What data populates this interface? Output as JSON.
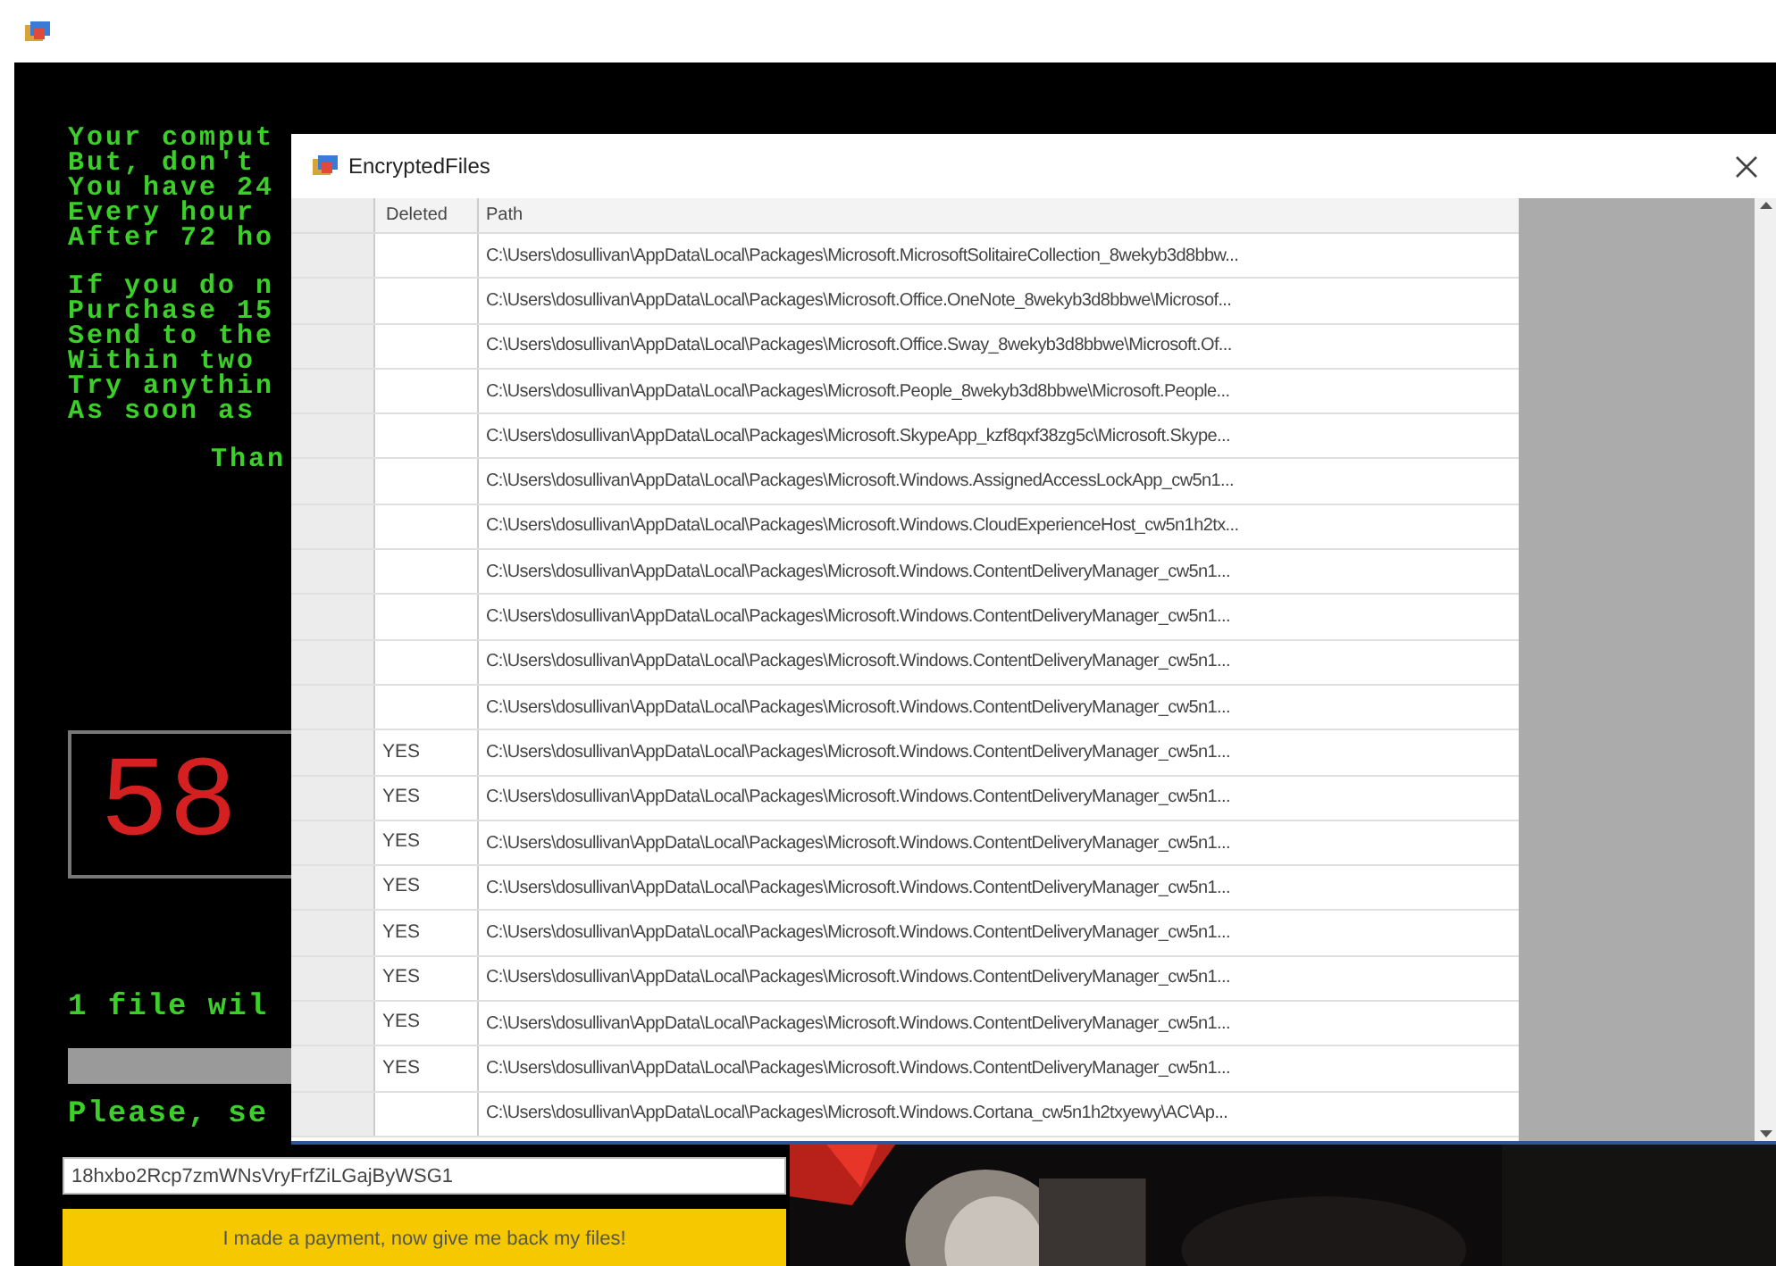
{
  "background_window": {
    "message_paragraphs": [
      {
        "kind": "body",
        "lines": [
          "Your comput",
          "But, don't",
          "You have 24",
          "Every hour",
          "After 72 ho"
        ]
      },
      {
        "kind": "body",
        "lines": [
          "If you do n",
          "Purchase 15",
          "Send to the",
          "Within two",
          "Try anythin",
          "As soon as"
        ]
      },
      {
        "kind": "signature",
        "lines": [
          "Than"
        ]
      }
    ],
    "timer": "58",
    "status_line": "1 file wil",
    "prompt_line": "Please, se",
    "address_field": {
      "value": "18hxbo2Rcp7zmWNsVryFrfZiLGajByWSG1"
    },
    "payment_button": "I made a payment, now give me back my files!"
  },
  "dialog": {
    "title": "EncryptedFiles",
    "table": {
      "columns": [
        "Deleted",
        "Path"
      ],
      "rows": [
        {
          "path": "C:\\Users\\dosullivan\\AppData\\Local\\Packages\\Microsoft.MicrosoftSolitaireCollection_8wekyb3d8bbw..."
        },
        {
          "path": "C:\\Users\\dosullivan\\AppData\\Local\\Packages\\Microsoft.Office.OneNote_8wekyb3d8bbwe\\Microsof..."
        },
        {
          "path": "C:\\Users\\dosullivan\\AppData\\Local\\Packages\\Microsoft.Office.Sway_8wekyb3d8bbwe\\Microsoft.Of..."
        },
        {
          "path": "C:\\Users\\dosullivan\\AppData\\Local\\Packages\\Microsoft.People_8wekyb3d8bbwe\\Microsoft.People..."
        },
        {
          "path": "C:\\Users\\dosullivan\\AppData\\Local\\Packages\\Microsoft.SkypeApp_kzf8qxf38zg5c\\Microsoft.Skype..."
        },
        {
          "path": "C:\\Users\\dosullivan\\AppData\\Local\\Packages\\Microsoft.Windows.AssignedAccessLockApp_cw5n1..."
        },
        {
          "path": "C:\\Users\\dosullivan\\AppData\\Local\\Packages\\Microsoft.Windows.CloudExperienceHost_cw5n1h2tx..."
        },
        {
          "path": "C:\\Users\\dosullivan\\AppData\\Local\\Packages\\Microsoft.Windows.ContentDeliveryManager_cw5n1..."
        },
        {
          "path": "C:\\Users\\dosullivan\\AppData\\Local\\Packages\\Microsoft.Windows.ContentDeliveryManager_cw5n1..."
        },
        {
          "path": "C:\\Users\\dosullivan\\AppData\\Local\\Packages\\Microsoft.Windows.ContentDeliveryManager_cw5n1..."
        },
        {
          "path": "C:\\Users\\dosullivan\\AppData\\Local\\Packages\\Microsoft.Windows.ContentDeliveryManager_cw5n1..."
        },
        {
          "deleted": "YES",
          "path": "C:\\Users\\dosullivan\\AppData\\Local\\Packages\\Microsoft.Windows.ContentDeliveryManager_cw5n1..."
        },
        {
          "deleted": "YES",
          "path": "C:\\Users\\dosullivan\\AppData\\Local\\Packages\\Microsoft.Windows.ContentDeliveryManager_cw5n1..."
        },
        {
          "deleted": "YES",
          "path": "C:\\Users\\dosullivan\\AppData\\Local\\Packages\\Microsoft.Windows.ContentDeliveryManager_cw5n1..."
        },
        {
          "deleted": "YES",
          "path": "C:\\Users\\dosullivan\\AppData\\Local\\Packages\\Microsoft.Windows.ContentDeliveryManager_cw5n1..."
        },
        {
          "deleted": "YES",
          "path": "C:\\Users\\dosullivan\\AppData\\Local\\Packages\\Microsoft.Windows.ContentDeliveryManager_cw5n1..."
        },
        {
          "deleted": "YES",
          "path": "C:\\Users\\dosullivan\\AppData\\Local\\Packages\\Microsoft.Windows.ContentDeliveryManager_cw5n1..."
        },
        {
          "deleted": "YES",
          "path": "C:\\Users\\dosullivan\\AppData\\Local\\Packages\\Microsoft.Windows.ContentDeliveryManager_cw5n1..."
        },
        {
          "deleted": "YES",
          "path": "C:\\Users\\dosullivan\\AppData\\Local\\Packages\\Microsoft.Windows.ContentDeliveryManager_cw5n1..."
        },
        {
          "path": "C:\\Users\\dosullivan\\AppData\\Local\\Packages\\Microsoft.Windows.Cortana_cw5n1h2txyewy\\AC\\Ap..."
        }
      ]
    }
  }
}
